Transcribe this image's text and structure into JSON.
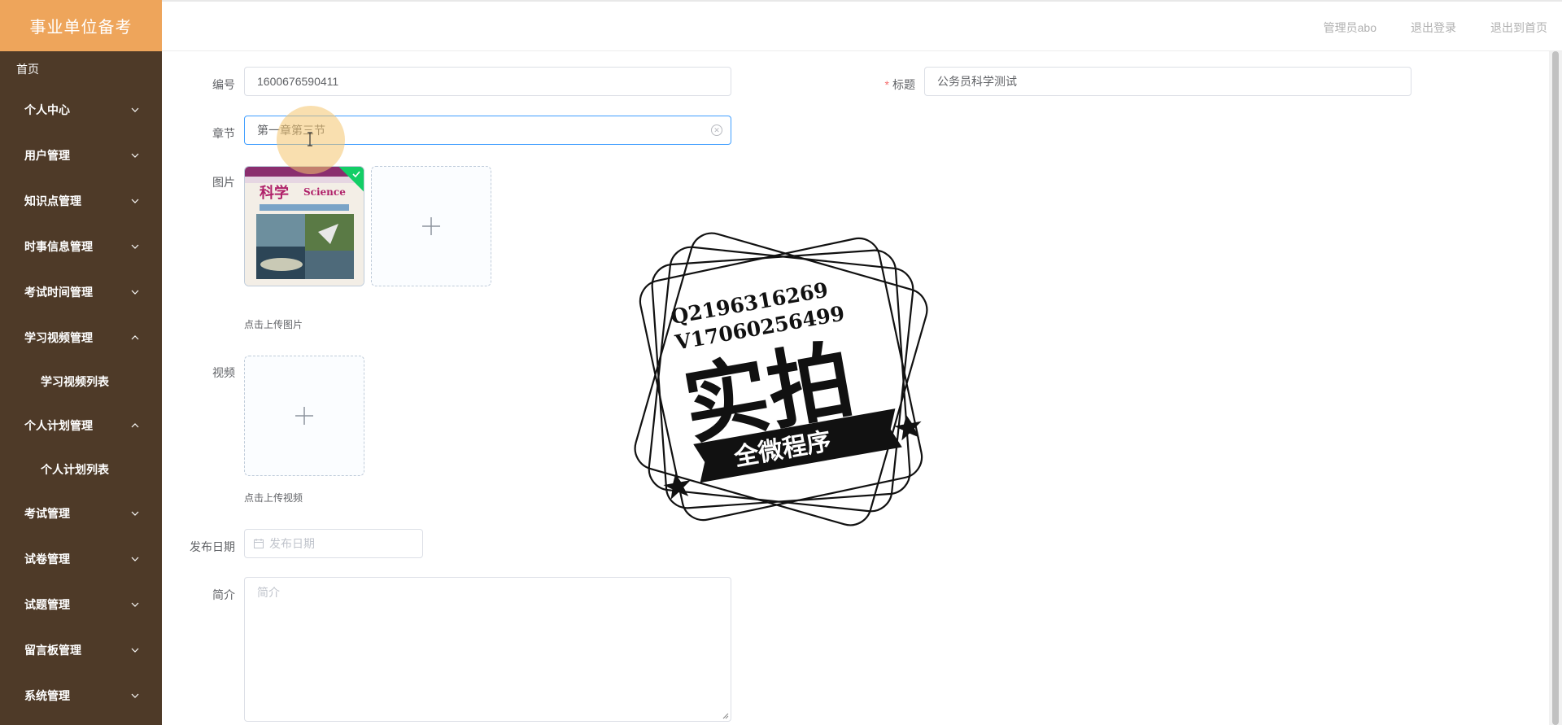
{
  "brand": {
    "title": "事业单位备考"
  },
  "sidebar": {
    "home": "首页",
    "items": [
      {
        "label": "个人中心",
        "state": "collapsed"
      },
      {
        "label": "用户管理",
        "state": "collapsed"
      },
      {
        "label": "知识点管理",
        "state": "collapsed"
      },
      {
        "label": "时事信息管理",
        "state": "collapsed"
      },
      {
        "label": "考试时间管理",
        "state": "collapsed"
      },
      {
        "label": "学习视频管理",
        "state": "expanded",
        "children": [
          "学习视频列表"
        ]
      },
      {
        "label": "个人计划管理",
        "state": "expanded",
        "children": [
          "个人计划列表"
        ]
      },
      {
        "label": "考试管理",
        "state": "collapsed"
      },
      {
        "label": "试卷管理",
        "state": "collapsed"
      },
      {
        "label": "试题管理",
        "state": "collapsed"
      },
      {
        "label": "留言板管理",
        "state": "collapsed"
      },
      {
        "label": "系统管理",
        "state": "collapsed"
      }
    ]
  },
  "header": {
    "user": "管理员abo",
    "logout": "退出登录",
    "to_home": "退出到首页"
  },
  "form": {
    "code": {
      "label": "编号",
      "value": "1600676590411"
    },
    "title": {
      "label": "标题",
      "required_mark": "*",
      "value": "公务员科学测试"
    },
    "chapter": {
      "label": "章节",
      "value": "第一章第三节"
    },
    "image": {
      "label": "图片",
      "tip": "点击上传图片"
    },
    "video": {
      "label": "视频",
      "tip": "点击上传视频"
    },
    "date": {
      "label": "发布日期",
      "placeholder": "发布日期"
    },
    "intro": {
      "label": "简介",
      "placeholder": "简介"
    }
  },
  "thumbnail": {
    "cover_title": "科学",
    "cover_subtitle": "Science"
  },
  "watermark": {
    "line1": "Q2196316269",
    "line2": "V17060256499",
    "big": "实拍",
    "banner": "全微程序"
  },
  "colors": {
    "brand": "#eea55b",
    "sidebar": "#4e3a28",
    "focus": "#409eff",
    "success": "#13ce66",
    "required": "#f56c6c"
  },
  "icons": [
    "chevron-down-icon",
    "chevron-up-icon",
    "plus-icon",
    "calendar-icon",
    "clear-icon",
    "check-icon"
  ]
}
